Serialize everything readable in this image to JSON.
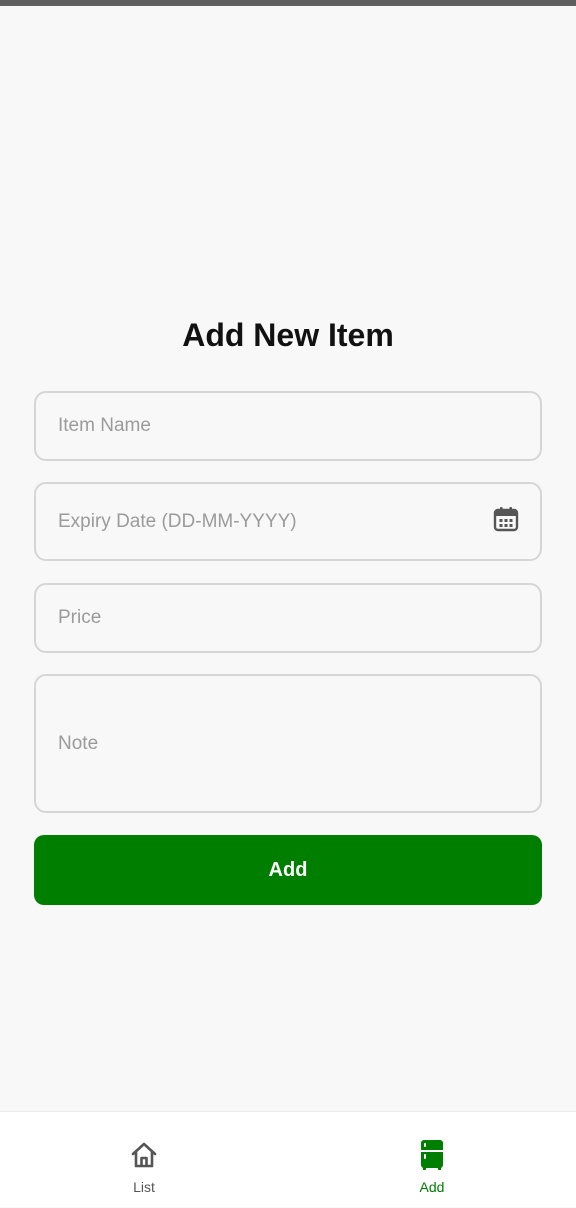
{
  "screen": {
    "title": "Add New Item"
  },
  "form": {
    "item_name": {
      "value": "",
      "placeholder": "Item Name"
    },
    "expiry_date": {
      "value": "",
      "placeholder": "Expiry Date (DD-MM-YYYY)",
      "icon": "calendar-icon"
    },
    "price": {
      "value": "",
      "placeholder": "Price"
    },
    "note": {
      "value": "",
      "placeholder": "Note"
    },
    "submit_label": "Add"
  },
  "bottom_nav": {
    "items": [
      {
        "label": "List",
        "icon": "home-icon",
        "active": false,
        "color": "#555555"
      },
      {
        "label": "Add",
        "icon": "fridge-icon",
        "active": true,
        "color": "#007e00"
      }
    ]
  },
  "colors": {
    "accent": "#007e00",
    "background": "#f8f8f8",
    "field_border": "#d6d6d6",
    "placeholder": "#9b9b9b"
  }
}
